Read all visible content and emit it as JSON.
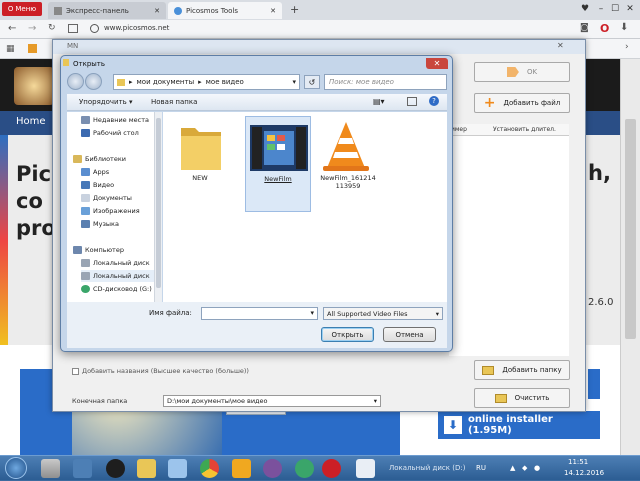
{
  "browser": {
    "menu_label": "Меню",
    "tabs": [
      {
        "label": "Экспресс-панель"
      },
      {
        "label": "Picosmos Tools"
      }
    ],
    "new_tab": "+",
    "url": "www.picosmos.net",
    "window_controls": {
      "minimize": "–",
      "maximize": "☐",
      "close": "✕"
    }
  },
  "site": {
    "nav_home": "Home",
    "hero_lines": [
      "Pic",
      "co",
      "pro"
    ],
    "hero_right": [
      "h,"
    ],
    "version_fragment": "2.6.0",
    "installer_label": "online installer (1.95M)"
  },
  "app": {
    "title": "MN",
    "ok_label": "OK",
    "add_file_label": "Добавить файл",
    "table_headers": [
      "имер",
      "Установить длител."
    ],
    "add_folder_label": "Добавить папку",
    "clear_label": "Очистить",
    "checkbox_label": "Добавить названия (Высшее качество (больше))",
    "destination_label": "Конечная папка",
    "destination_value": "D:\\мои документы\\мое видео"
  },
  "dialog": {
    "title": "Открыть",
    "breadcrumb": [
      "мои документы",
      "мое видео"
    ],
    "search_placeholder": "Поиск: мое видео",
    "organize_label": "Упорядочить ▾",
    "new_folder_label": "Новая папка",
    "nav_items": [
      {
        "label": "Недавние места",
        "icon": "recent-places-icon",
        "indent": 2
      },
      {
        "label": "Рабочий стол",
        "icon": "desktop-icon",
        "indent": 2
      },
      {
        "label": "Библиотеки",
        "icon": "libraries-icon",
        "indent": 1
      },
      {
        "label": "Apps",
        "icon": "apps-icon",
        "indent": 2
      },
      {
        "label": "Видео",
        "icon": "video-library-icon",
        "indent": 2
      },
      {
        "label": "Документы",
        "icon": "documents-icon",
        "indent": 2
      },
      {
        "label": "Изображения",
        "icon": "images-icon",
        "indent": 2
      },
      {
        "label": "Музыка",
        "icon": "music-icon",
        "indent": 2
      },
      {
        "label": "Компьютер",
        "icon": "computer-icon",
        "indent": 1
      },
      {
        "label": "Локальный диск",
        "icon": "local-disk-icon",
        "indent": 2
      },
      {
        "label": "Локальный диск",
        "icon": "local-disk-icon",
        "indent": 2
      },
      {
        "label": "CD-дисковод (G:)",
        "icon": "cd-drive-icon",
        "indent": 2
      }
    ],
    "files": [
      {
        "name": "NEW",
        "icon": "folder-icon"
      },
      {
        "name": "NewFilm",
        "icon": "video-thumbnail-icon"
      },
      {
        "name": "NewFilm_161214 113959",
        "icon": "vlc-cone-icon"
      }
    ],
    "filename_label": "Имя файла:",
    "filename_value": "",
    "filetype_value": "All Supported Video Files",
    "open_label": "Открыть",
    "cancel_label": "Отмена"
  },
  "taskbar": {
    "tray_text": "Локальный диск (D:)",
    "lang": "RU",
    "time": "11:51",
    "date": "14.12.2016"
  }
}
